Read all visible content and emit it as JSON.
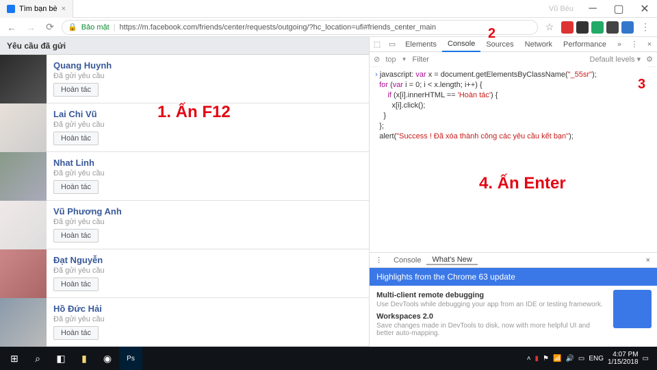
{
  "window": {
    "tab_title": "Tìm bạn bè",
    "user": "Vũ Béu"
  },
  "address": {
    "secure": "Bảo mật",
    "url": "https://m.facebook.com/friends/center/requests/outgoing/?hc_location=ufi#friends_center_main"
  },
  "fb": {
    "header": "Yêu cầu đã gửi",
    "sent_label": "Đã gửi yêu cầu",
    "undo": "Hoàn tác",
    "friends": [
      {
        "name": "Quang Huynh"
      },
      {
        "name": "Lai Chi Vũ"
      },
      {
        "name": "Nhat Linh"
      },
      {
        "name": "Vũ Phương Anh"
      },
      {
        "name": "Đạt Nguyễn"
      },
      {
        "name": "Hồ Đức Hải"
      }
    ]
  },
  "dev": {
    "tabs": {
      "elements": "Elements",
      "console": "Console",
      "sources": "Sources",
      "network": "Network",
      "performance": "Performance"
    },
    "toolbar": {
      "top": "top",
      "filter": "Filter",
      "levels": "Default levels ▾"
    },
    "code": {
      "l1a": "javascript: ",
      "l1b": "var",
      "l1c": " x = document.getElementsByClassName(",
      "l1d": "\"_55sr\"",
      "l1e": ");",
      "l2a": "for",
      "l2b": " (",
      "l2c": "var",
      "l2d": " i = 0; i < x.length; i++) {",
      "l3a": "    if",
      "l3b": " (x[i].innerHTML == ",
      "l3c": "'Hoàn tác'",
      "l3d": ") {",
      "l4": "        x[i].click();",
      "l5": "    }",
      "l6": "};",
      "l7a": "alert(",
      "l7b": "\"Success ! Đã xóa thành công các yêu cầu kết bạn\"",
      "l7c": ");"
    }
  },
  "whatsnew": {
    "tab_console": "Console",
    "tab_wn": "What's New",
    "banner": "Highlights from the Chrome 63 update",
    "h1": "Multi-client remote debugging",
    "p1": "Use DevTools while debugging your app from an IDE or testing framework.",
    "h2": "Workspaces 2.0",
    "p2": "Save changes made in DevTools to disk, now with more helpful UI and better auto-mapping."
  },
  "tray": {
    "lang": "ENG",
    "time": "4:07 PM",
    "date": "1/15/2018"
  },
  "annot": {
    "s1": "1. Ấn F12",
    "s2": "2",
    "s3": "3",
    "s4": "4. Ấn Enter"
  }
}
